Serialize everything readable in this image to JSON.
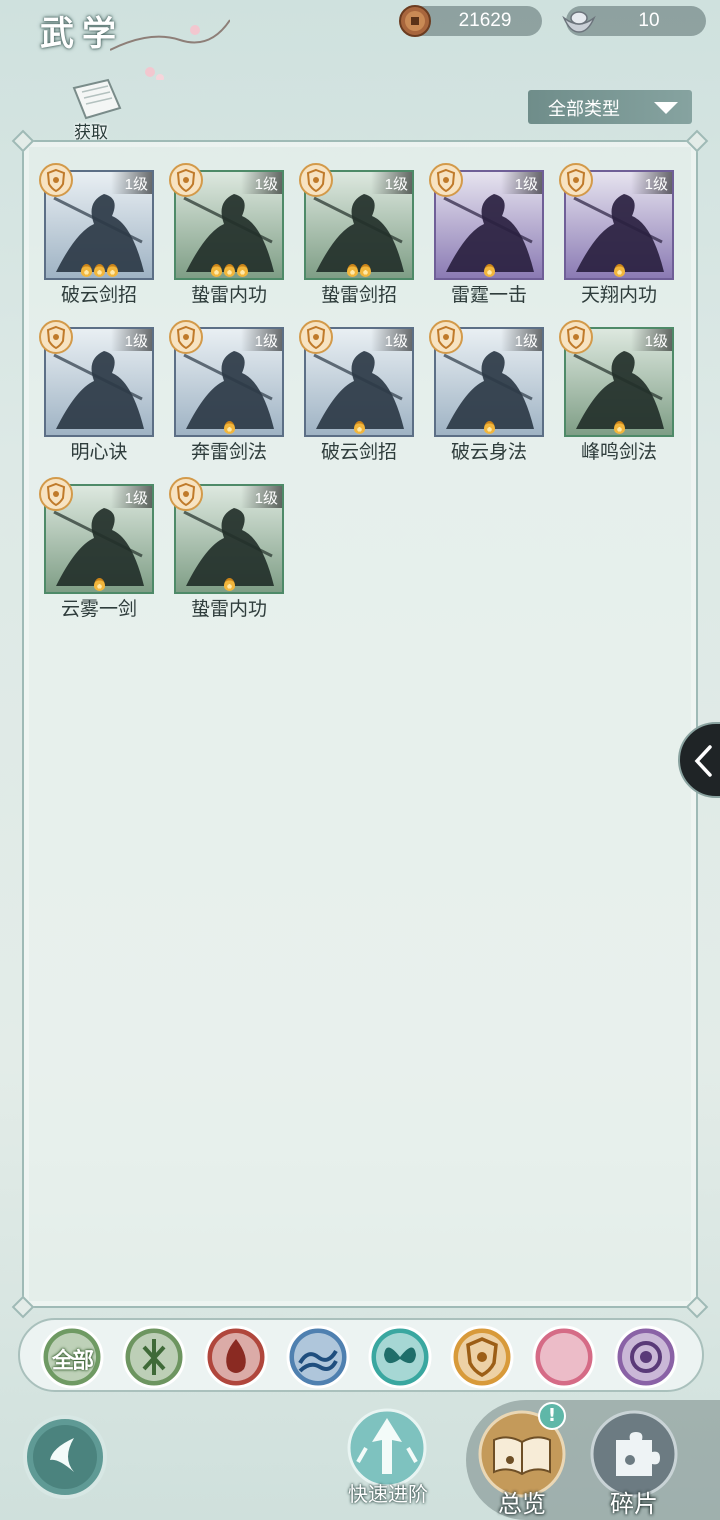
{
  "header": {
    "title": "武学",
    "currencies": [
      {
        "name": "copper-coin",
        "value": "21629"
      },
      {
        "name": "silver-ingot",
        "value": "10"
      }
    ]
  },
  "toolbar": {
    "get_label": "获取",
    "filter_label": "全部类型"
  },
  "skills": [
    {
      "name": "破云剑招",
      "level": "1级",
      "flames": 3,
      "tone": "blue"
    },
    {
      "name": "蛰雷内功",
      "level": "1级",
      "flames": 3,
      "tone": "green"
    },
    {
      "name": "蛰雷剑招",
      "level": "1级",
      "flames": 2,
      "tone": "green"
    },
    {
      "name": "雷霆一击",
      "level": "1级",
      "flames": 1,
      "tone": "purple"
    },
    {
      "name": "天翔内功",
      "level": "1级",
      "flames": 1,
      "tone": "purple"
    },
    {
      "name": "明心诀",
      "level": "1级",
      "flames": 0,
      "tone": "blue"
    },
    {
      "name": "奔雷剑法",
      "level": "1级",
      "flames": 1,
      "tone": "blue"
    },
    {
      "name": "破云剑招",
      "level": "1级",
      "flames": 1,
      "tone": "blue"
    },
    {
      "name": "破云身法",
      "level": "1级",
      "flames": 1,
      "tone": "blue"
    },
    {
      "name": "峰鸣剑法",
      "level": "1级",
      "flames": 1,
      "tone": "green"
    },
    {
      "name": "云雾一剑",
      "level": "1级",
      "flames": 1,
      "tone": "green"
    },
    {
      "name": "蛰雷内功",
      "level": "1级",
      "flames": 1,
      "tone": "green"
    }
  ],
  "categories": [
    {
      "icon": "all-category-icon",
      "label": "全部",
      "color": "#6f9a63"
    },
    {
      "icon": "bamboo-category-icon",
      "color": "#6d9560"
    },
    {
      "icon": "fire-category-icon",
      "color": "#b0463c"
    },
    {
      "icon": "wave-category-icon",
      "color": "#4f80b0"
    },
    {
      "icon": "butterfly-category-icon",
      "color": "#3aa7a0"
    },
    {
      "icon": "shield-category-icon",
      "color": "#d89a3a"
    },
    {
      "icon": "moon-category-icon",
      "color": "#d56b86"
    },
    {
      "icon": "flower-category-icon",
      "color": "#8a62a6"
    }
  ],
  "bottom": {
    "quick_label": "快速进阶",
    "overview_label": "总览",
    "fragments_label": "碎片",
    "alert_mark": "!"
  }
}
